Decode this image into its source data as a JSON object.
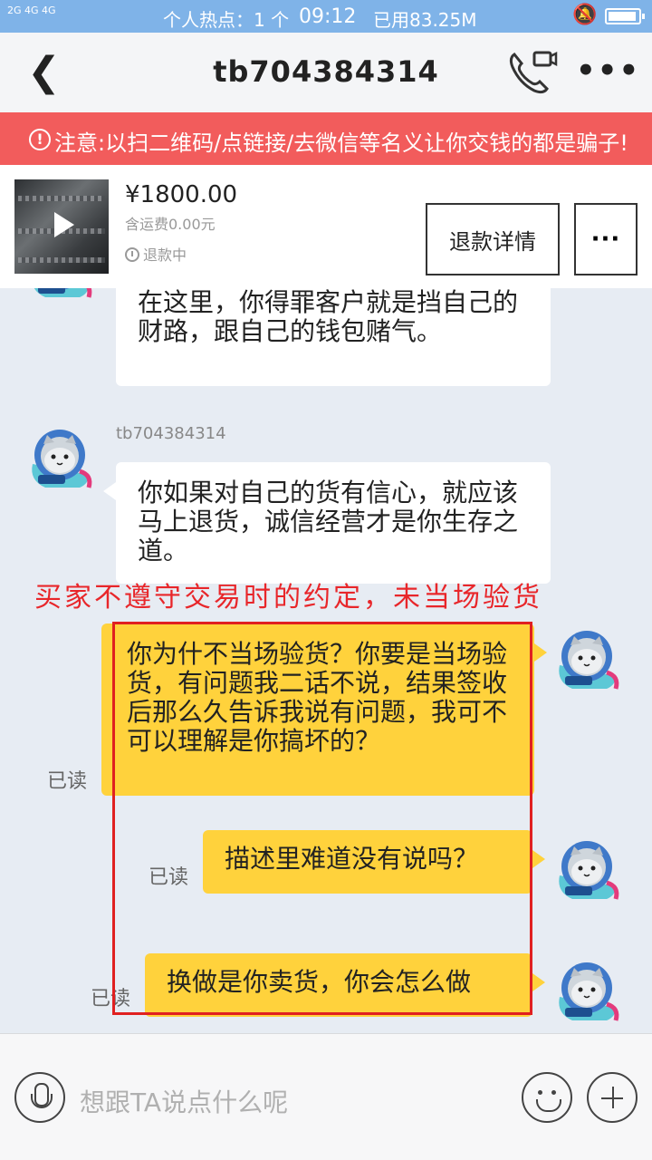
{
  "status_bar": {
    "signal": "2G 4G 4G",
    "hotspot": "个人热点：1 个",
    "time": "09:12",
    "data_used": "已用83.25M",
    "battery_level": 0.95
  },
  "nav": {
    "title": "tb704384314",
    "call_icon": "video-call-icon",
    "more_icon": "more-icon"
  },
  "warning": {
    "text": "注意:以扫二维码/点链接/去微信等名义让你交钱的都是骗子!"
  },
  "product": {
    "price": "¥1800.00",
    "shipping": "含运费0.00元",
    "status": "退款中",
    "refund_button": "退款详情",
    "more_button": "···"
  },
  "messages": [
    {
      "side": "left",
      "text": "在这里，你得罪客户就是挡自己的财路，跟自己的钱包赌气。"
    },
    {
      "side": "left",
      "sender": "tb704384314",
      "text": "你如果对自己的货有信心，就应该马上退货，诚信经营才是你生存之道。"
    },
    {
      "side": "right",
      "read": "已读",
      "text": "你为什不当场验货？你要是当场验货，有问题我二话不说，结果签收后那么久告诉我说有问题，我可不可以理解是你搞坏的？"
    },
    {
      "side": "right",
      "read": "已读",
      "text": "描述里难道没有说吗？"
    },
    {
      "side": "right",
      "read": "已读",
      "text": "换做是你卖货，你会怎么做"
    }
  ],
  "annotation": "买家不遵守交易时的约定，未当场验货",
  "input": {
    "placeholder": "想跟TA说点什么呢"
  },
  "colors": {
    "status_bar": "#7fb3e8",
    "warning": "#f25c5c",
    "bubble_self": "#ffd23c",
    "annotation": "#e8262a"
  }
}
